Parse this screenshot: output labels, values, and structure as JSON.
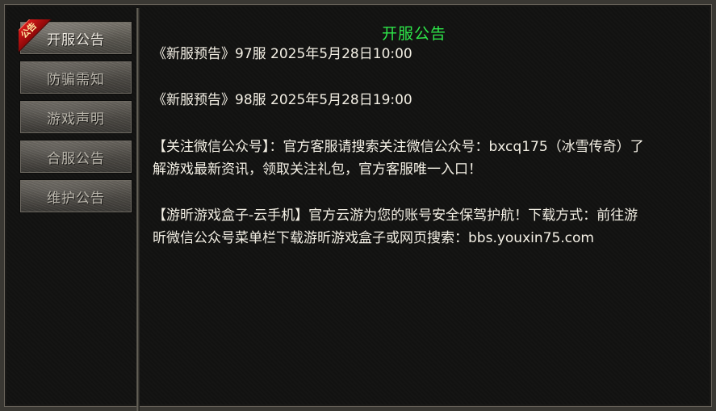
{
  "sidebar": {
    "badge_text": "公告",
    "items": [
      {
        "label": "开服公告",
        "active": true
      },
      {
        "label": "防骗需知",
        "active": false
      },
      {
        "label": "游戏声明",
        "active": false
      },
      {
        "label": "合服公告",
        "active": false
      },
      {
        "label": "维护公告",
        "active": false
      }
    ]
  },
  "content": {
    "title": "开服公告",
    "lines": [
      "《新服预告》97服 2025年5月28日10:00",
      "《新服预告》98服 2025年5月28日19:00",
      "【关注微信公众号】：官方客服请搜索关注微信公众号：bxcq175（冰雪传奇）了",
      "解游戏最新资讯，领取关注礼包，官方客服唯一入口！",
      "【游昕游戏盒子-云手机】官方云游为您的账号安全保驾护航！下载方式：前往游",
      "昕微信公众号菜单栏下载游昕游戏盒子或网页搜索：bbs.youxin75.com"
    ]
  },
  "colors": {
    "title": "#2ee84a",
    "text": "#f3efe4",
    "badge": "#c81212",
    "background": "#121211"
  }
}
